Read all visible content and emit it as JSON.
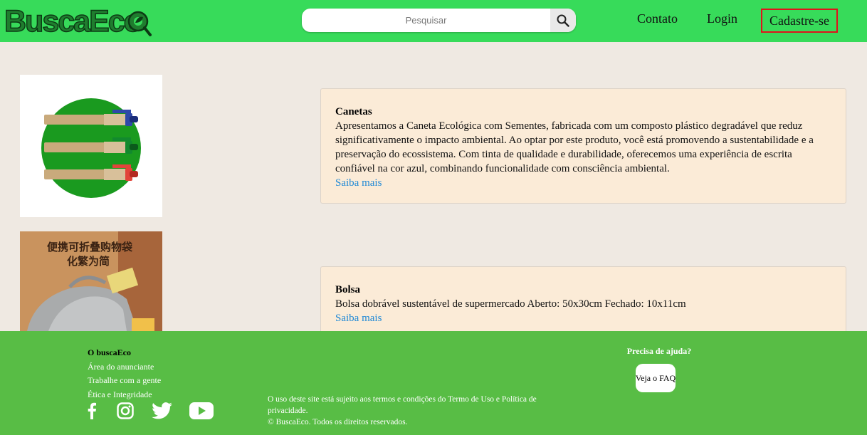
{
  "header": {
    "logo_text": "BuscaEco",
    "search": {
      "placeholder": "Pesquisar",
      "value": ""
    },
    "nav": {
      "contato": "Contato",
      "login": "Login",
      "signup": "Cadastre-se"
    }
  },
  "products": [
    {
      "title": "Canetas",
      "description": "Apresentamos a Caneta Ecológica com Sementes, fabricada com um composto plástico degradável que reduz significativamente o impacto ambiental. Ao optar por este produto, você está promovendo a sustentabilidade e a preservação do ecossistema. Com tinta de qualidade e durabilidade, oferecemos uma experiência de escrita confiável na cor azul, combinando funcionalidade com consciência ambiental.",
      "link": "Saiba mais"
    },
    {
      "title": "Bolsa",
      "description": "Bolsa dobrável sustentável de supermercado Aberto: 50x30cm Fechado: 10x11cm",
      "link": "Saiba mais",
      "image_text_line1": "便携可折叠购物袋",
      "image_text_line2": "化繁为简"
    }
  ],
  "footer": {
    "col1": {
      "title": "O buscaEco",
      "links": [
        "Área do anunciante",
        "Trabalhe com a gente",
        "Ética e Integridade"
      ]
    },
    "socials": [
      "facebook-icon",
      "instagram-icon",
      "twitter-icon",
      "youtube-icon"
    ],
    "legal_line1": "O uso deste site está sujeito aos termos e condições do Termo de Uso e Política de privacidade.",
    "legal_line2": "© BuscaEco. Todos os direitos reservados.",
    "help_title": "Precisa de ajuda?",
    "faq_button": "Veja o FAQ"
  },
  "colors": {
    "header_bg": "#37db5a",
    "page_bg": "#efe9e2",
    "card_bg": "#fbebd7",
    "footer_bg": "#58bd45",
    "link": "#1e88d6",
    "signup_border": "#e0141b"
  }
}
